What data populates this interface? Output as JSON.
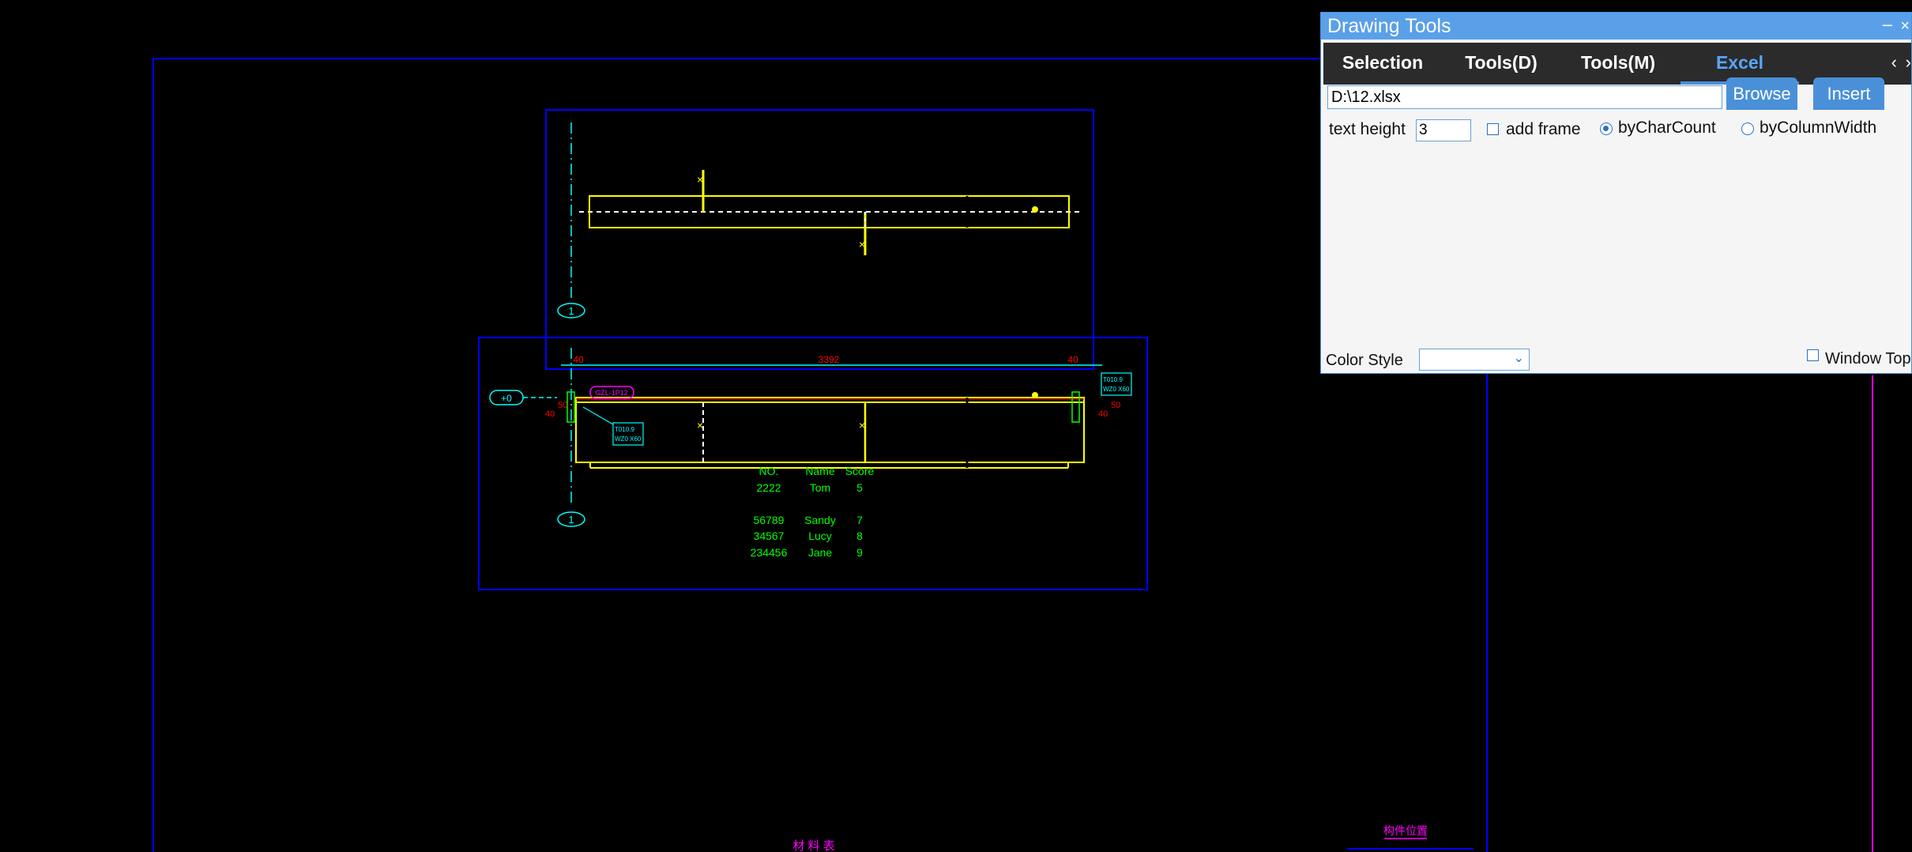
{
  "cad": {
    "dimension_total": "3392",
    "dimension_left": "40",
    "dimension_right": "40",
    "axis_label": "1",
    "axis_label_lower": "1",
    "elevation_tag": "+0",
    "dim_small_left_a": "50",
    "dim_small_left_b": "40",
    "dim_small_right_a": "50",
    "dim_small_right_b": "40",
    "tag_left_line1": "T010.9",
    "tag_left_line2": "WZ0 X60",
    "tag_right_line1": "T010.9",
    "tag_right_line2": "WZ0 X60",
    "member_tag": "GZL-1P12",
    "table": {
      "headers": [
        "NO.",
        "Name",
        "Score"
      ],
      "rows": [
        [
          "2222",
          "Tom",
          "5"
        ],
        [
          "",
          "",
          ""
        ],
        [
          "56789",
          "Sandy",
          "7"
        ],
        [
          "34567",
          "Lucy",
          "8"
        ],
        [
          "234456",
          "Jane",
          "9"
        ]
      ]
    },
    "bottom_title": "材 料 表",
    "bottom_right_title": "构件位置",
    "colors": {
      "frame_blue": "#0000ff",
      "member_yellow": "#ffff00",
      "axis_cyan": "#00ffff",
      "dim_red": "#ff0000",
      "table_green": "#00ff00",
      "accent_magenta": "#ff00ff"
    }
  },
  "panel": {
    "title": "Drawing Tools",
    "minimize": "–",
    "close": "×",
    "tabs": [
      {
        "label": "Selection",
        "active": false
      },
      {
        "label": "Tools(D)",
        "active": false
      },
      {
        "label": "Tools(M)",
        "active": false
      },
      {
        "label": "Excel",
        "active": true
      }
    ],
    "prev": "‹",
    "next": "›",
    "file_path": "D:\\12.xlsx",
    "browse_label": "Browse",
    "insert_label": "Insert",
    "text_height_label": "text height",
    "text_height_value": "3",
    "add_frame_label": "add frame",
    "add_frame_checked": false,
    "by_char_count_label": "byCharCount",
    "by_char_count_selected": true,
    "by_column_width_label": "byColumnWidth",
    "by_column_width_selected": false,
    "color_style_label": "Color Style",
    "color_style_value": "",
    "window_top_label": "Window Top",
    "window_top_checked": false
  }
}
